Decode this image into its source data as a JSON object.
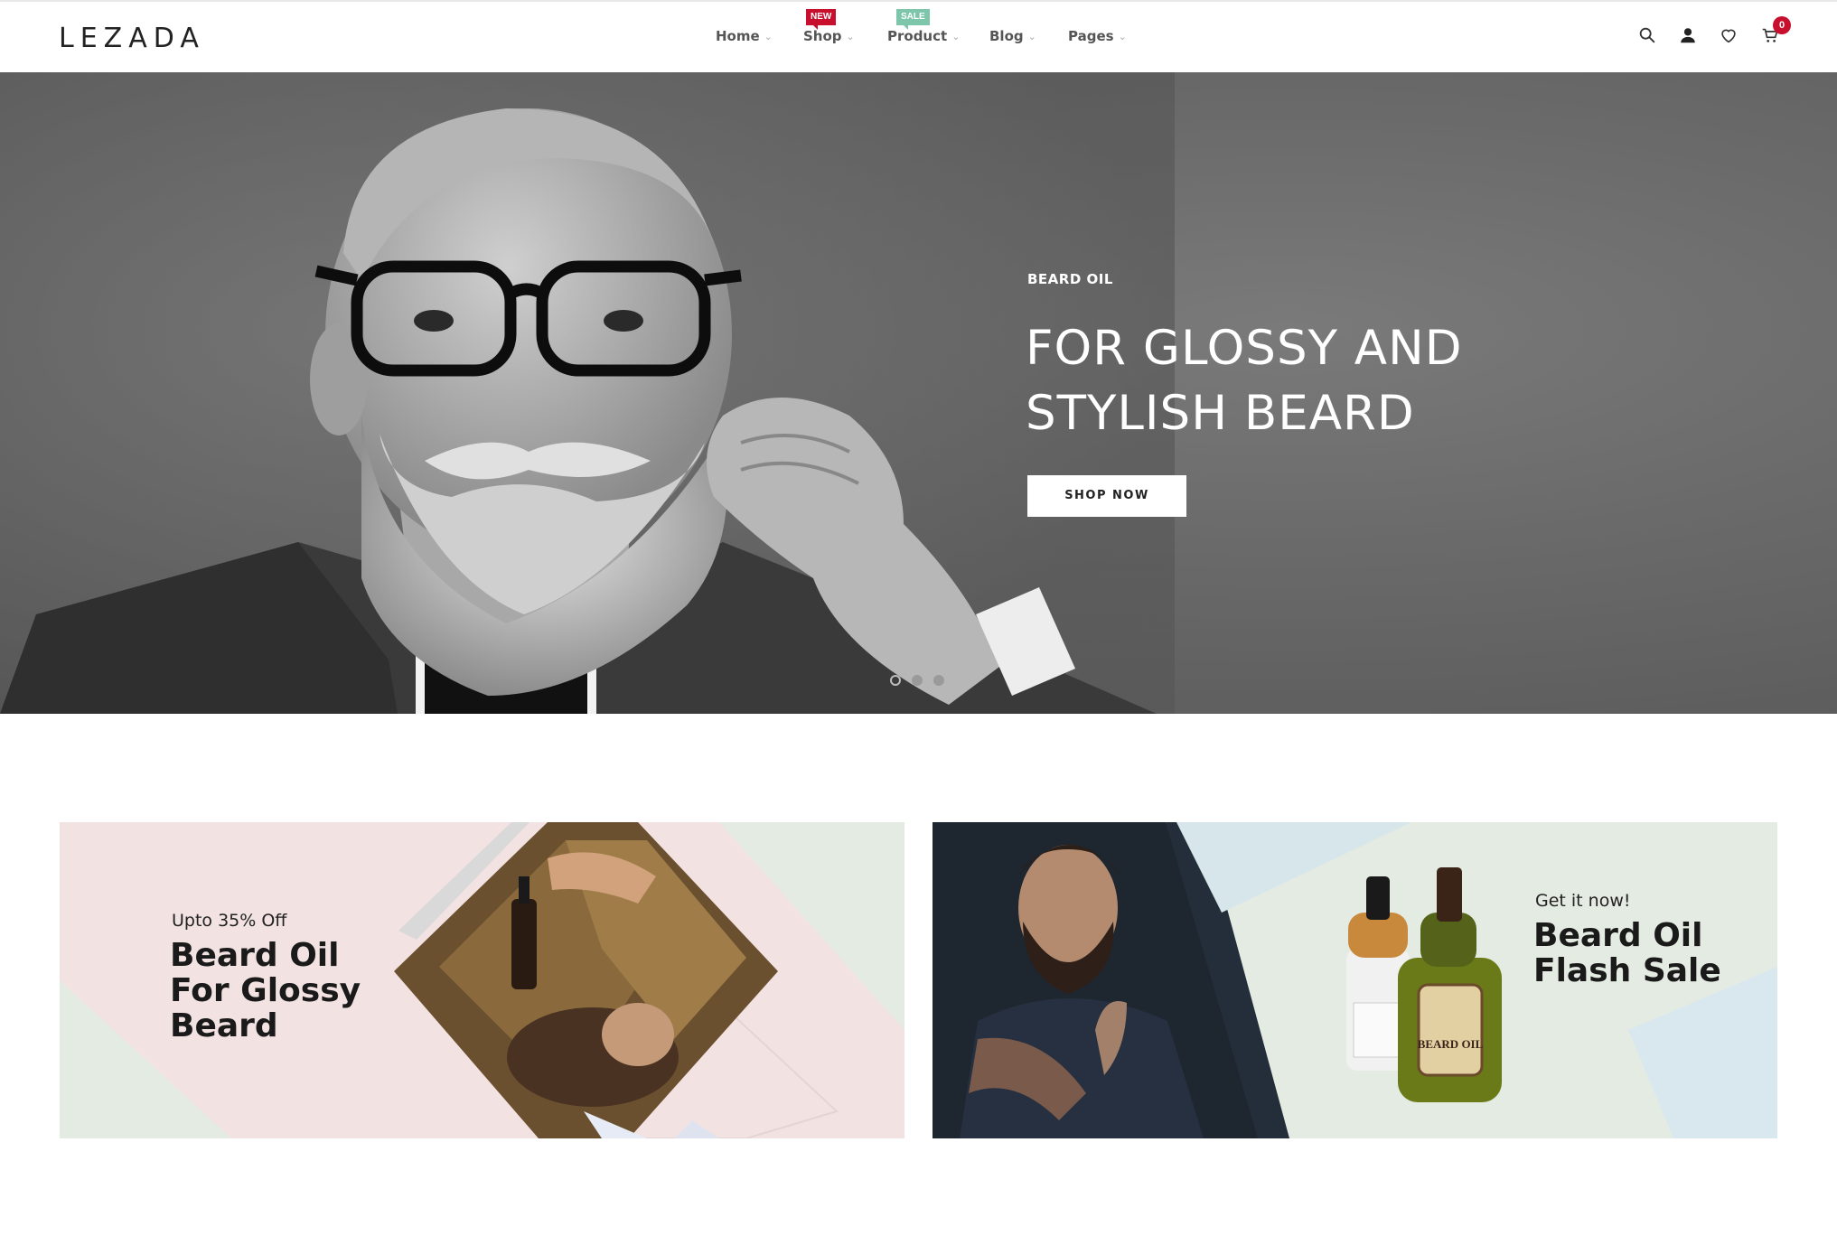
{
  "header": {
    "logo": "LEZADA",
    "nav": [
      {
        "label": "Home"
      },
      {
        "label": "Shop",
        "badge": "NEW"
      },
      {
        "label": "Product",
        "badge": "SALE"
      },
      {
        "label": "Blog"
      },
      {
        "label": "Pages"
      }
    ],
    "icons": [
      "search-icon",
      "user-icon",
      "heart-icon",
      "cart-icon"
    ],
    "cart_count": "0"
  },
  "hero": {
    "subtitle": "BEARD OIL",
    "title": "FOR GLOSSY AND STYLISH BEARD",
    "button": "SHOP NOW",
    "slides": 3,
    "active_slide": 1
  },
  "banners": [
    {
      "subtitle": "Upto 35% Off",
      "title": "Beard Oil For Glossy Beard",
      "background": "#f2e2e2"
    },
    {
      "subtitle": "Get it now!",
      "title": "Beard Oil Flash Sale",
      "background": "#e4ebe2"
    }
  ],
  "colors": {
    "accent": "#c8102e",
    "sale": "#7dc6ac"
  }
}
